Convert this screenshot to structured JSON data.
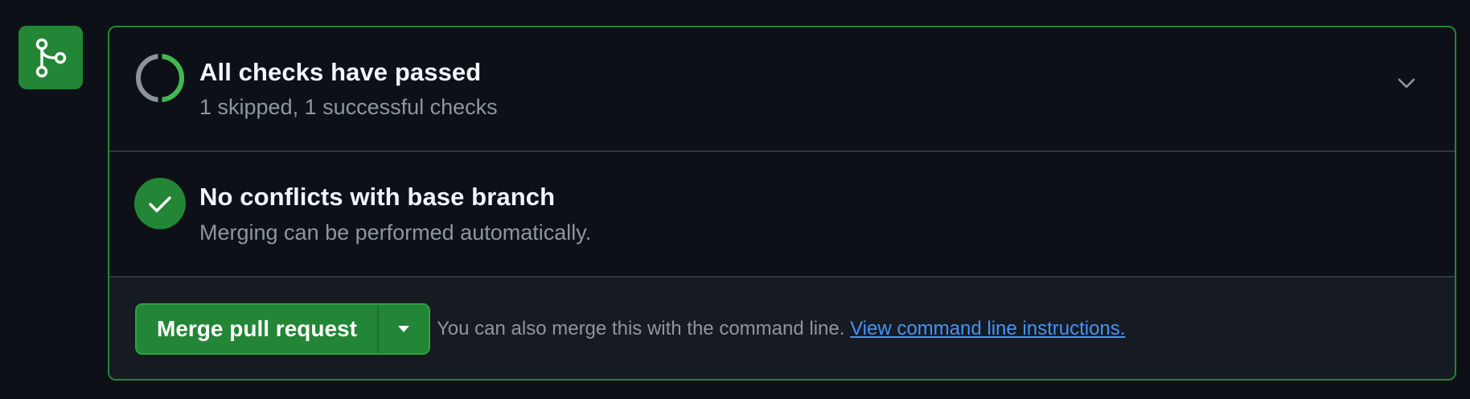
{
  "icons": {
    "merge_badge": "git-merge-icon",
    "checks_status": "partial-ring-icon",
    "conflicts_status": "check-circle-icon",
    "expand": "chevron-down-icon",
    "merge_dropdown": "triangle-down-icon"
  },
  "colors": {
    "success": "#238636",
    "ring_success": "#3fb950",
    "ring_skipped": "#8b949e",
    "link": "#4493f8"
  },
  "checks": {
    "title": "All checks have passed",
    "subtitle": "1 skipped, 1 successful checks"
  },
  "conflicts": {
    "title": "No conflicts with base branch",
    "subtitle": "Merging can be performed automatically."
  },
  "merge": {
    "button_label": "Merge pull request",
    "hint_text": "You can also merge this with the command line. ",
    "link_text": "View command line instructions."
  }
}
